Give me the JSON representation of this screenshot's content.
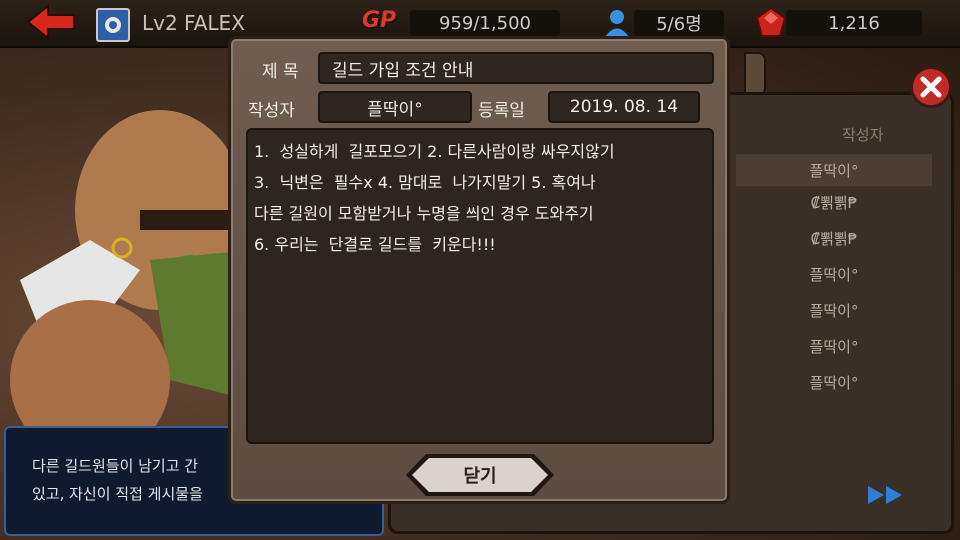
{
  "top_bar": {
    "player_name": "Lv2 FALEX",
    "gp_label": "GP",
    "gp_value": "959/1,500",
    "members_value": "5/6명",
    "gems_value": "1,216"
  },
  "info_panel": {
    "line1": "다른 길드원들이 남기고 간",
    "line2": "있고, 자신이 직접 게시물을"
  },
  "board": {
    "author_header": "작성자",
    "authors": [
      "플딱이°",
      "₡뾝뾝₱",
      "₡뾝뾝₱",
      "플딱이°",
      "플딱이°",
      "플딱이°",
      "플딱이°"
    ]
  },
  "post": {
    "title_label": "제 목",
    "title": "길드 가입 조건 안내",
    "author_label": "작성자",
    "author": "플딱이°",
    "date_label": "등록일",
    "date": "2019. 08. 14",
    "body": "1.  성실하게  길포모으기 2. 다른사람이랑 싸우지않기\n3.  닉변은  필수x 4. 맘대로  나가지말기 5. 혹여나\n다른 길원이 모함받거나 누명을 씌인 경우 도와주기\n6. 우리는  단결로 길드를  키운다!!!",
    "close_label": "닫기"
  },
  "colors": {
    "accent_red": "#e3372b",
    "modal_bg": "#6e5d50",
    "panel_bg": "#2e251f"
  }
}
